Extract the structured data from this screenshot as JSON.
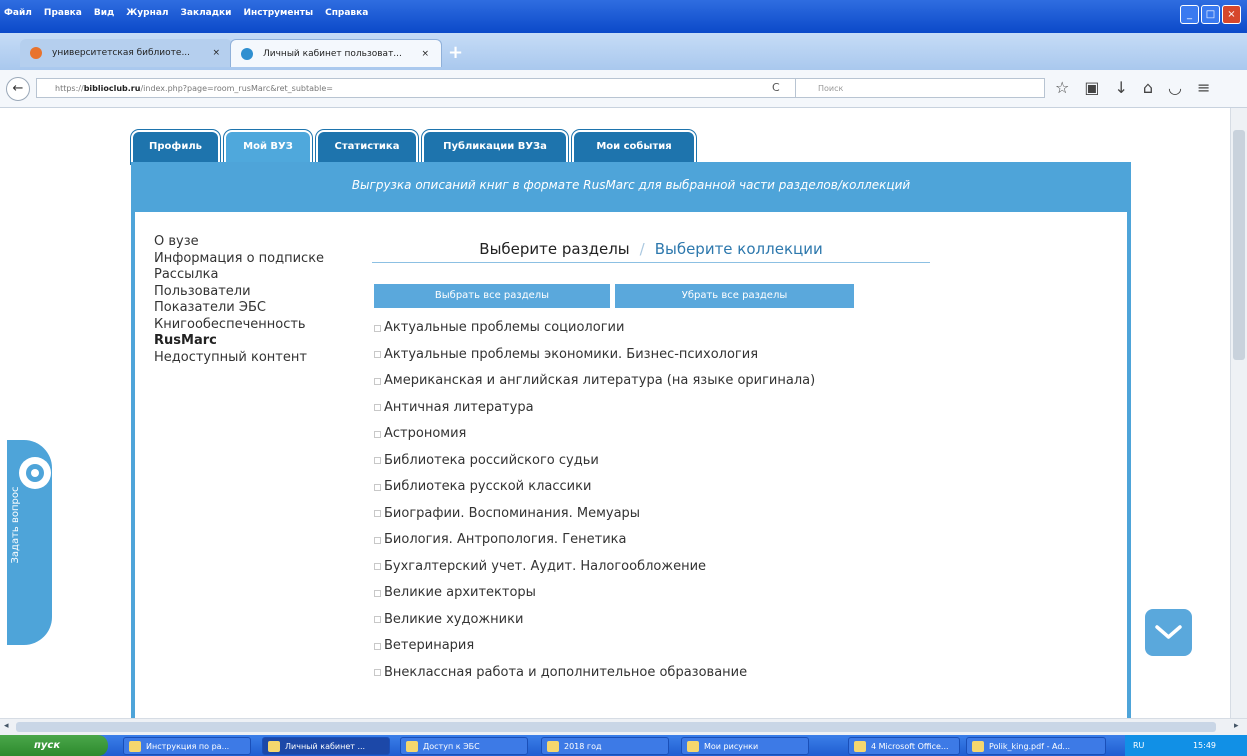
{
  "browser": {
    "menu": [
      "Файл",
      "Правка",
      "Вид",
      "Журнал",
      "Закладки",
      "Инструменты",
      "Справка"
    ],
    "tabs": [
      {
        "label": "университетская библиоте...",
        "active": false
      },
      {
        "label": "Личный кабинет пользоват...",
        "active": true
      }
    ],
    "close_glyph": "×",
    "new_tab": "+",
    "url_prefix": "https://",
    "url_domain": "biblioclub.ru",
    "url_rest": "/index.php?page=room_rusMarc&ret_subtable=",
    "search_placeholder": "Поиск"
  },
  "site_tabs": [
    {
      "label": "Профиль",
      "active": false
    },
    {
      "label": "Мой ВУЗ",
      "active": true
    },
    {
      "label": "Статистика",
      "active": false
    },
    {
      "label": "Публикации ВУЗа",
      "active": false
    },
    {
      "label": "Мои события",
      "active": false
    }
  ],
  "banner_text": "Выгрузка описаний книг в формате RusMarc для выбранной части разделов/коллекций",
  "left_nav": [
    {
      "label": "О вузе",
      "current": false
    },
    {
      "label": "Информация о подписке",
      "current": false
    },
    {
      "label": "Рассылка",
      "current": false
    },
    {
      "label": "Пользователи",
      "current": false
    },
    {
      "label": "Показатели ЭБС",
      "current": false
    },
    {
      "label": "Книгообеспеченность",
      "current": false
    },
    {
      "label": "RusMarc",
      "current": true
    },
    {
      "label": "Недоступный контент",
      "current": false
    }
  ],
  "selector": {
    "sections_label": "Выберите разделы",
    "separator": "/",
    "collections_label": "Выберите коллекции"
  },
  "buttons": {
    "select_all": "Выбрать все разделы",
    "deselect_all": "Убрать все разделы"
  },
  "sections": [
    "Актуальные проблемы социологии",
    "Актуальные проблемы экономики. Бизнес-психология",
    "Американская и английская литература (на языке оригинала)",
    "Античная литература",
    "Астрономия",
    "Библиотека российского судьи",
    "Библиотека русской классики",
    "Биографии. Воспоминания. Мемуары",
    "Биология. Антропология. Генетика",
    "Бухгалтерский учет. Аудит. Налогообложение",
    "Великие архитекторы",
    "Великие художники",
    "Ветеринария",
    "Внеклассная работа и дополнительное образование"
  ],
  "ask_question": "Задать вопрос",
  "taskbar": {
    "start": "пуск",
    "items": [
      {
        "label": "Инструкция по ра...",
        "active": false
      },
      {
        "label": "Личный кабинет ...",
        "active": true
      },
      {
        "label": "Доступ к ЭБС",
        "active": false
      },
      {
        "label": "2018 год",
        "active": false
      },
      {
        "label": "Мои рисунки",
        "active": false
      },
      {
        "label": "4 Microsoft Office...",
        "active": false
      },
      {
        "label": "Polik_king.pdf - Ad...",
        "active": false
      }
    ],
    "tray_lang": "RU",
    "tray_time": "15:49"
  }
}
